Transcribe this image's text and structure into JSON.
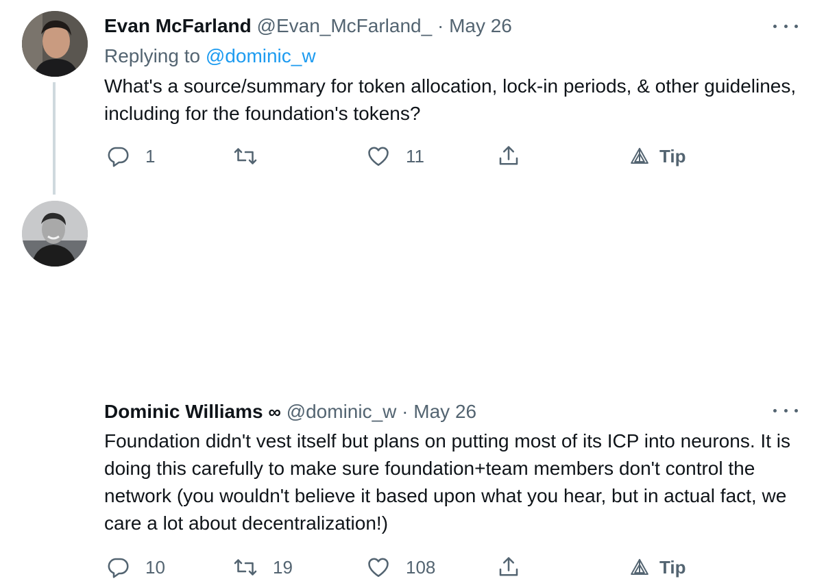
{
  "tweets": [
    {
      "author": "Evan McFarland",
      "handle": "@Evan_McFarland_",
      "separator": "·",
      "date": "May 26",
      "replying_prefix": "Replying to",
      "replying_to": "@dominic_w",
      "text": "What's a source/summary for token allocation, lock-in periods, & other guidelines, including for the foundation's tokens?",
      "replies": "1",
      "retweets": "",
      "likes": "11",
      "tip_label": "Tip"
    },
    {
      "author": "Dominic Williams",
      "author_symbol": "∞",
      "handle": "@dominic_w",
      "separator": "·",
      "date": "May 26",
      "text": "Foundation didn't vest itself but plans on putting most of its ICP into neurons. It is doing this carefully to make sure foundation+team members don't control the network (you wouldn't believe it based upon what you hear, but in actual fact, we care a lot about decentralization!)",
      "replies": "10",
      "retweets": "19",
      "likes": "108",
      "tip_label": "Tip"
    }
  ],
  "icons": {
    "reply": "reply-icon",
    "retweet": "retweet-icon",
    "like": "heart-icon",
    "share": "share-icon",
    "tip": "tip-icon",
    "more": "more-icon"
  },
  "colors": {
    "text": "#0f1419",
    "secondary": "#536471",
    "link": "#1d9bf0",
    "thread_line": "#cfd9de"
  }
}
